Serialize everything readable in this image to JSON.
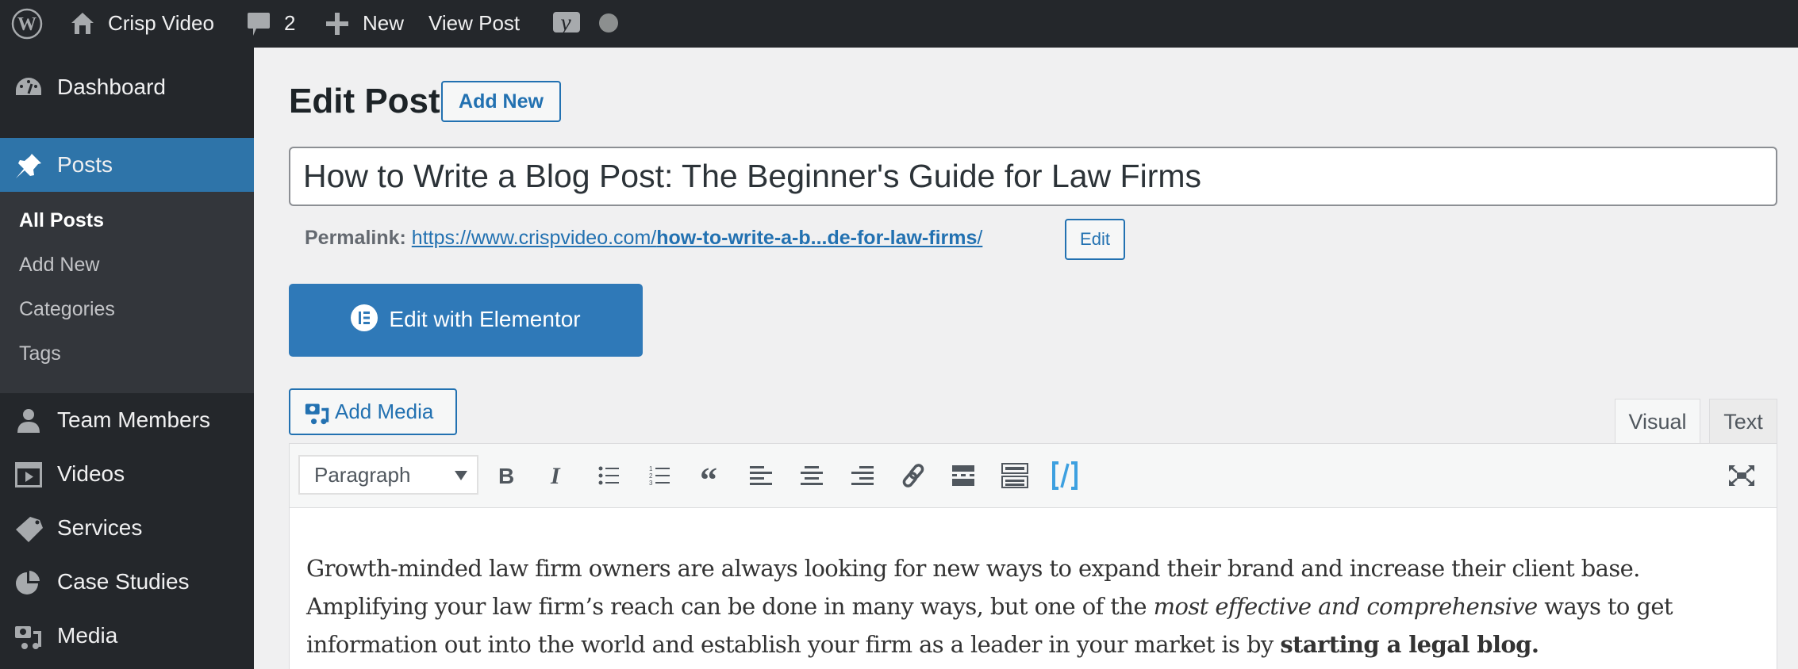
{
  "admin_bar": {
    "site_name": "Crisp Video",
    "comments_count": "2",
    "new_label": "New",
    "view_post_label": "View Post",
    "icons": [
      "wordpress-logo-icon",
      "home-icon",
      "comment-icon",
      "plus-icon",
      "yoast-icon",
      "status-dot-icon"
    ]
  },
  "sidebar": {
    "items": [
      {
        "label": "Dashboard",
        "icon": "dashboard-icon"
      },
      {
        "label": "Posts",
        "icon": "pin-icon",
        "active": true
      },
      {
        "label": "Team Members",
        "icon": "user-icon"
      },
      {
        "label": "Videos",
        "icon": "video-icon"
      },
      {
        "label": "Services",
        "icon": "tag-icon"
      },
      {
        "label": "Case Studies",
        "icon": "pie-chart-icon"
      },
      {
        "label": "Media",
        "icon": "media-icon"
      }
    ],
    "submenu": [
      {
        "label": "All Posts",
        "current": true
      },
      {
        "label": "Add New"
      },
      {
        "label": "Categories"
      },
      {
        "label": "Tags"
      }
    ]
  },
  "page": {
    "title": "Edit Post",
    "add_new_label": "Add New",
    "post_title_value": "How to Write a Blog Post: The Beginner's Guide for Law Firms",
    "permalink": {
      "label": "Permalink:",
      "base": "https://www.crispvideo.com/",
      "slug": "how-to-write-a-b...de-for-law-firms",
      "trailing": "/",
      "edit_label": "Edit"
    },
    "elementor_label": "Edit with Elementor",
    "add_media_label": "Add Media"
  },
  "editor": {
    "tabs": [
      {
        "label": "Visual",
        "active": true
      },
      {
        "label": "Text"
      }
    ],
    "format_select_value": "Paragraph",
    "toolbar_buttons": [
      "bold",
      "italic",
      "bulleted-list",
      "numbered-list",
      "blockquote",
      "align-left",
      "align-center",
      "align-right",
      "insert-link",
      "read-more",
      "toolbar-toggle",
      "shortcode"
    ],
    "content": {
      "part1": "Growth-minded law firm owners are always looking for new ways to expand their brand and increase their client base. Amplifying your law firm’s reach can be done in many ways, but one of the ",
      "italic": "most effective and comprehensive",
      "part2": " ways to get information out into the world and establish your firm as a leader in your market is by ",
      "bold": "starting a legal blog."
    }
  },
  "colors": {
    "admin_bar_bg": "#24272b",
    "sidebar_active": "#2e74a9",
    "link": "#2271b1",
    "shortcode_icon": "#3da0e0"
  }
}
